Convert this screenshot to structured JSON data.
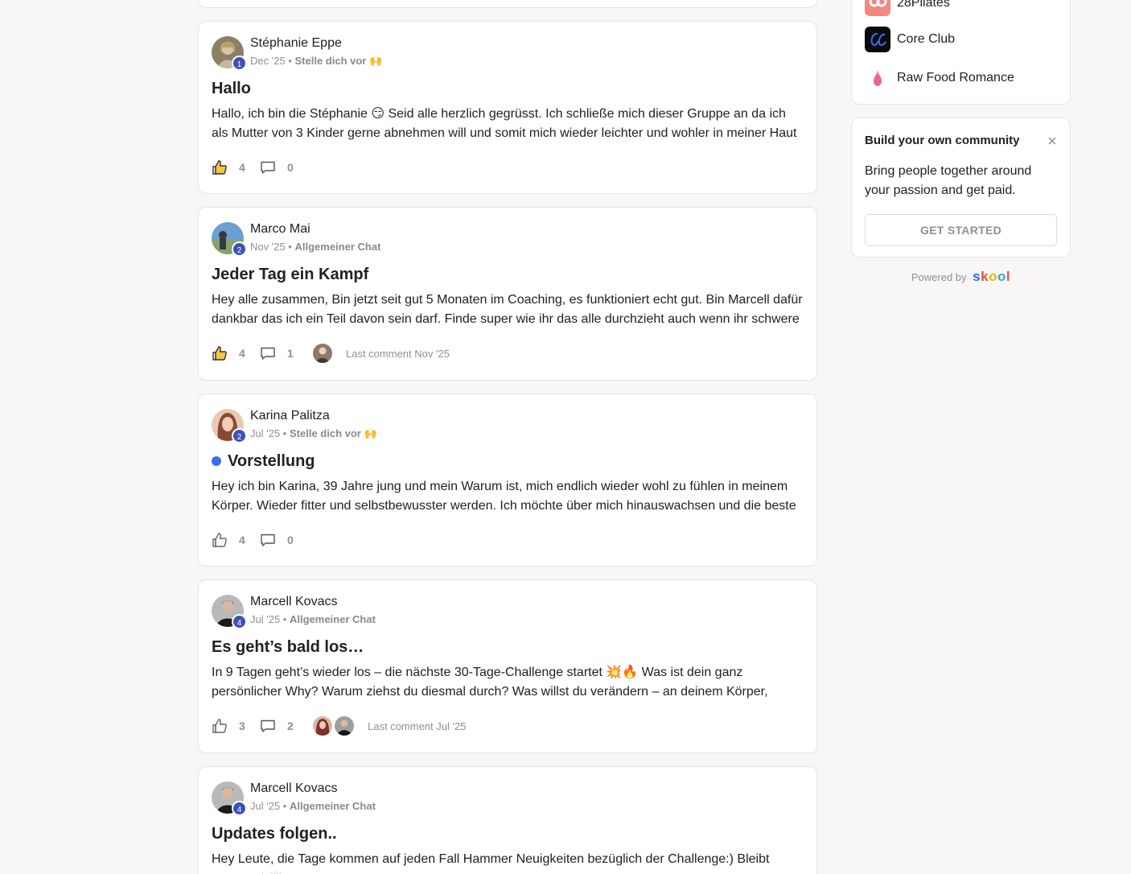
{
  "posts": [
    {
      "author": "Stéphanie Eppe",
      "level": "1",
      "date": "Dec '25",
      "separator": "•",
      "category": "Stelle dich vor 🙌",
      "title": "Hallo",
      "body": "Hallo, ich bin die Stéphanie 😏 Seid alle herzlich gegrüsst. Ich schließe mich dieser Gruppe an da ich als Mutter von 3 Kinder gerne abnehmen will und somit mich wieder leichter und wohler in meiner Haut zu",
      "likes": "4",
      "comments": "0",
      "liked": true,
      "last_comment": ""
    },
    {
      "author": "Marco Mai",
      "level": "2",
      "date": "Nov '25",
      "separator": "•",
      "category": "Allgemeiner Chat",
      "title": "Jeder Tag ein Kampf",
      "body": "Hey alle zusammen, Bin jetzt seit gut 5 Monaten im Coaching, es funktioniert echt gut. Bin Marcell dafür dankbar das ich ein Teil davon sein darf. Finde super wie ihr das alle durchzieht auch wenn ihr schwere",
      "likes": "4",
      "comments": "1",
      "liked": true,
      "last_comment": "Last comment Nov '25"
    },
    {
      "author": "Karina Palitza",
      "level": "2",
      "date": "Jul '25",
      "separator": "•",
      "category": "Stelle dich vor 🙌",
      "title": "Vorstellung",
      "body": "Hey ich bin Karina, 39 Jahre jung und mein Warum ist, mich endlich wieder wohl zu fühlen in meinem Körper. Wieder fitter und selbstbewusster werden. Ich möchte über mich hinauswachsen und die beste",
      "likes": "4",
      "comments": "0",
      "liked": false,
      "unread": true,
      "last_comment": ""
    },
    {
      "author": "Marcell Kovacs",
      "level": "4",
      "date": "Jul '25",
      "separator": "•",
      "category": "Allgemeiner Chat",
      "title": "Es geht’s bald los…",
      "body": "In 9 Tagen geht’s wieder los – die nächste 30-Tage-Challenge startet 💥🔥 Was ist dein ganz persönlicher Why? Warum ziehst du diesmal durch? Was willst du verändern – an deinem Körper,",
      "likes": "3",
      "comments": "2",
      "liked": false,
      "last_comment": "Last comment Jul '25"
    },
    {
      "author": "Marcell Kovacs",
      "level": "4",
      "date": "Jul '25",
      "separator": "•",
      "category": "Allgemeiner Chat",
      "title": "Updates folgen..",
      "body": "Hey Leute, die Tage kommen auf jeden Fall Hammer Neuigkeiten bezüglich der Challenge:) Bleibt gespannt 🙌🏻",
      "likes": "",
      "comments": "",
      "liked": false,
      "last_comment": ""
    }
  ],
  "sidebar": {
    "groups": [
      {
        "name": "28Pilates",
        "color": "#f08a7e",
        "icon": "28pilates-logo"
      },
      {
        "name": "Core Club",
        "color": "#0b0b0b",
        "icon": "core-club-logo"
      },
      {
        "name": "Raw Food Romance",
        "color": "#ffffff",
        "icon": "raw-food-romance-logo"
      }
    ],
    "build": {
      "title": "Build your own community",
      "text": "Bring people together around your passion and get paid.",
      "button": "GET STARTED"
    },
    "powered_by": "Powered by",
    "brand": "skool"
  },
  "colors": {
    "level_badge": "#3f51b5",
    "unread_dot": "#3b6ff0",
    "like_active": "#f5c542"
  }
}
